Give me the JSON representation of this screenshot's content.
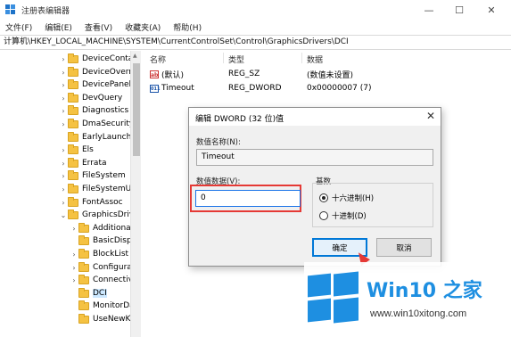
{
  "window": {
    "title": "注册表编辑器",
    "controls": {
      "minimize": "—",
      "maximize": "☐",
      "close": "✕"
    }
  },
  "menu": [
    "文件(F)",
    "编辑(E)",
    "查看(V)",
    "收藏夹(A)",
    "帮助(H)"
  ],
  "address": "计算机\\HKEY_LOCAL_MACHINE\\SYSTEM\\CurrentControlSet\\Control\\GraphicsDrivers\\DCI",
  "tree": {
    "items": [
      {
        "label": "DeviceContai",
        "chevron": "›"
      },
      {
        "label": "DeviceOverri",
        "chevron": "›"
      },
      {
        "label": "DevicePanels",
        "chevron": "›"
      },
      {
        "label": "DevQuery",
        "chevron": "›"
      },
      {
        "label": "Diagnostics",
        "chevron": "›"
      },
      {
        "label": "DmaSecurity",
        "chevron": "›"
      },
      {
        "label": "EarlyLaunch",
        "chevron": ""
      },
      {
        "label": "Els",
        "chevron": "›"
      },
      {
        "label": "Errata",
        "chevron": "›"
      },
      {
        "label": "FileSystem",
        "chevron": "›"
      },
      {
        "label": "FileSystemUti",
        "chevron": "›"
      },
      {
        "label": "FontAssoc",
        "chevron": "›"
      },
      {
        "label": "GraphicsDriv",
        "chevron": "⌄"
      },
      {
        "label": "Additional",
        "chevron": "›"
      },
      {
        "label": "BasicDispl",
        "chevron": ""
      },
      {
        "label": "BlockList",
        "chevron": "›"
      },
      {
        "label": "Configurat",
        "chevron": "›"
      },
      {
        "label": "Connectivi",
        "chevron": "›"
      },
      {
        "label": "DCI",
        "chevron": "",
        "selected": true
      },
      {
        "label": "MonitorDa",
        "chevron": ""
      },
      {
        "label": "UseNewKe",
        "chevron": ""
      }
    ]
  },
  "list": {
    "headers": {
      "name": "名称",
      "type": "类型",
      "data": "数据"
    },
    "rows": [
      {
        "name": "(默认)",
        "type": "REG_SZ",
        "data": "(数值未设置)",
        "icon": "ab"
      },
      {
        "name": "Timeout",
        "type": "REG_DWORD",
        "data": "0x00000007 (7)",
        "icon": "011"
      }
    ]
  },
  "dialog": {
    "title": "编辑 DWORD (32 位)值",
    "close": "✕",
    "name_label": "数值名称(N):",
    "name_value": "Timeout",
    "data_label": "数值数据(V):",
    "data_value": "0",
    "base_label": "基数",
    "radio_hex": "十六进制(H)",
    "radio_dec": "十进制(D)",
    "ok": "确定",
    "cancel": "取消"
  },
  "watermark": {
    "main": "Win10 之家",
    "sub": "www.win10xitong.com"
  }
}
